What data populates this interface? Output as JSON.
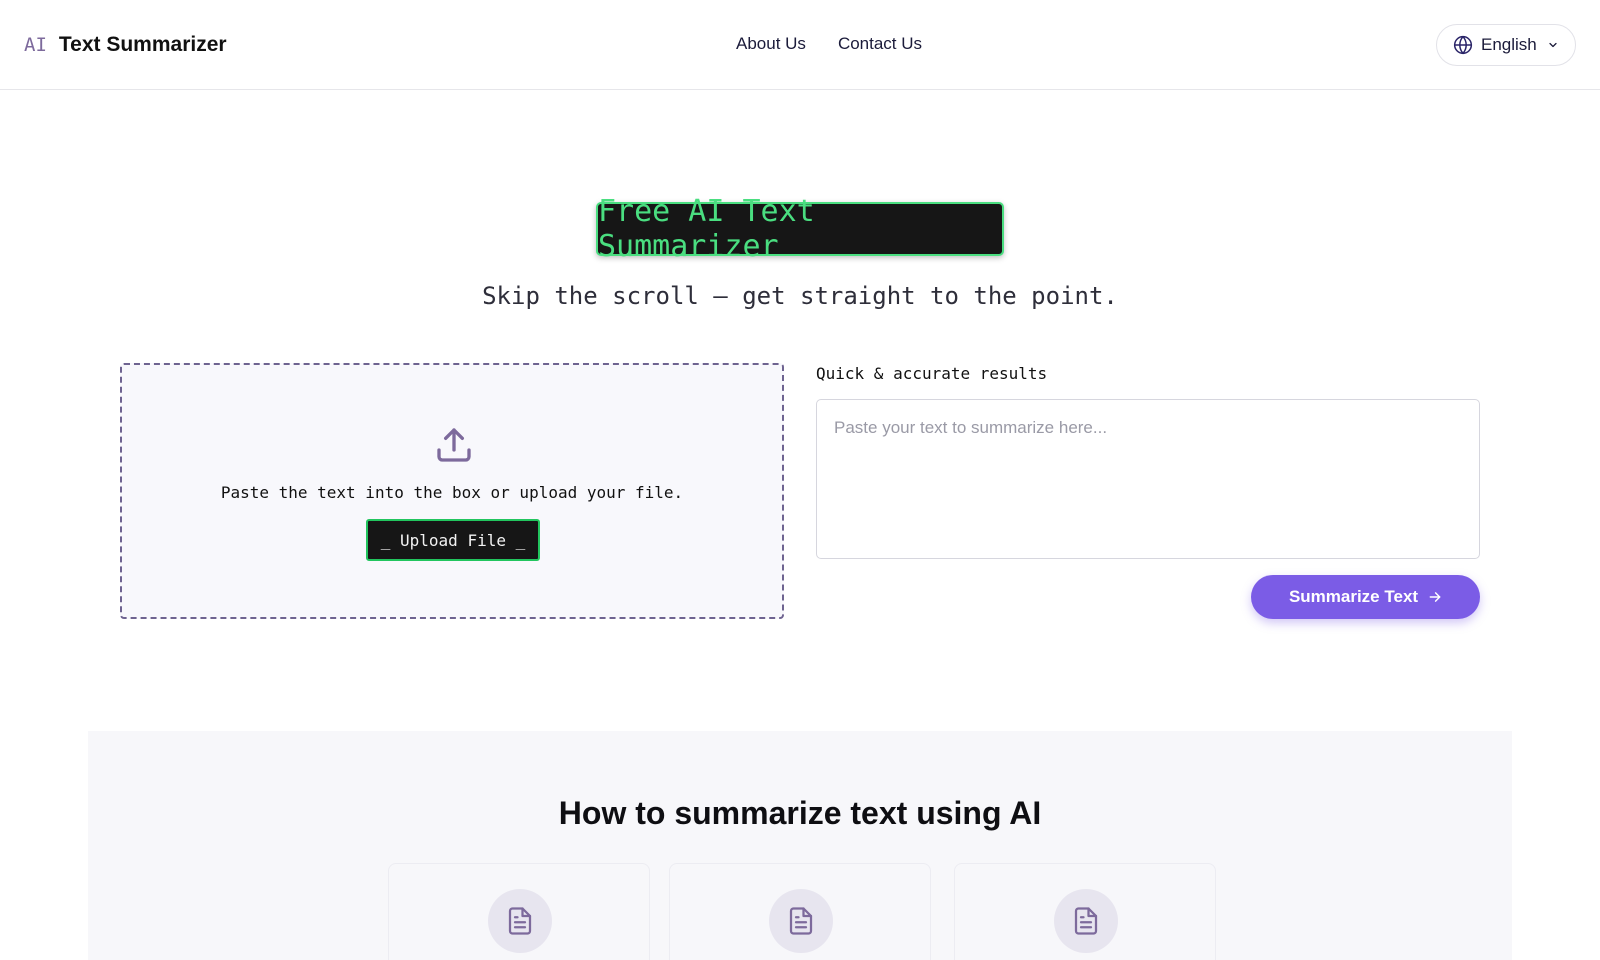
{
  "header": {
    "logo_badge": "AI",
    "logo_title": "Text Summarizer",
    "nav": [
      {
        "label": "About Us"
      },
      {
        "label": "Contact Us"
      }
    ],
    "language": {
      "selected": "English",
      "icon": "globe-icon",
      "chevron": "chevron-down-icon"
    }
  },
  "hero": {
    "title": "Free AI Text Summarizer",
    "subtitle": "Skip the scroll — get straight to the point."
  },
  "upload": {
    "icon": "upload-icon",
    "instructions": "Paste the text into the box or upload your file.",
    "button_label": "_ Upload File _"
  },
  "editor": {
    "label": "Quick & accurate results",
    "value": "",
    "placeholder": "Paste your text to summarize here...",
    "submit_label": "Summarize Text",
    "submit_icon": "arrow-right-icon"
  },
  "howto": {
    "title": "How to summarize text using AI",
    "cards": [
      {
        "icon": "document-icon"
      },
      {
        "icon": "document-icon"
      },
      {
        "icon": "document-icon"
      }
    ]
  },
  "colors": {
    "accent": "#7b5ce6",
    "terminal_green": "#4ade80",
    "terminal_bg": "#161616",
    "logo_ai": "#7d6a9c"
  }
}
